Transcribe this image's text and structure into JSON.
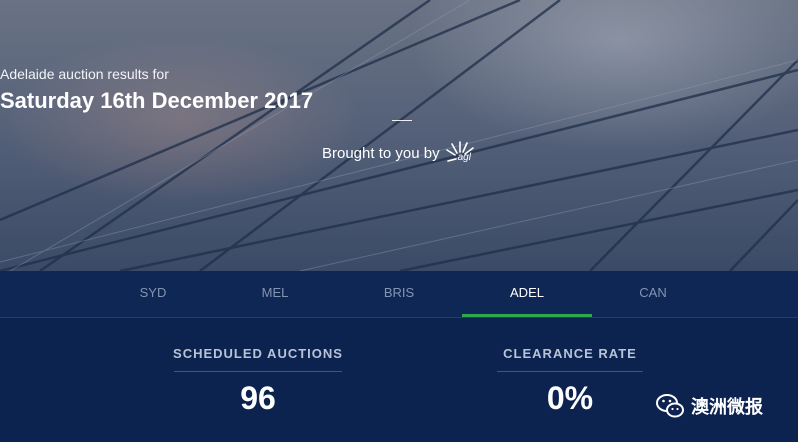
{
  "hero": {
    "subtitle": "Adelaide auction results for",
    "date_title": "Saturday 16th December 2017",
    "sponsor_text": "Brought to you by",
    "sponsor_logo_text": "agl"
  },
  "tabs": [
    {
      "label": "SYD",
      "active": false
    },
    {
      "label": "MEL",
      "active": false
    },
    {
      "label": "BRIS",
      "active": false
    },
    {
      "label": "ADEL",
      "active": true
    },
    {
      "label": "CAN",
      "active": false
    }
  ],
  "stats": {
    "scheduled_label": "SCHEDULED AUCTIONS",
    "scheduled_value": "96",
    "clearance_label": "CLEARANCE RATE",
    "clearance_value": "0%"
  },
  "watermark": {
    "text": "澳洲微报"
  },
  "colors": {
    "active_tab_underline": "#2aa84a",
    "nav_background": "#0f2754",
    "stats_background": "#0c2350"
  }
}
